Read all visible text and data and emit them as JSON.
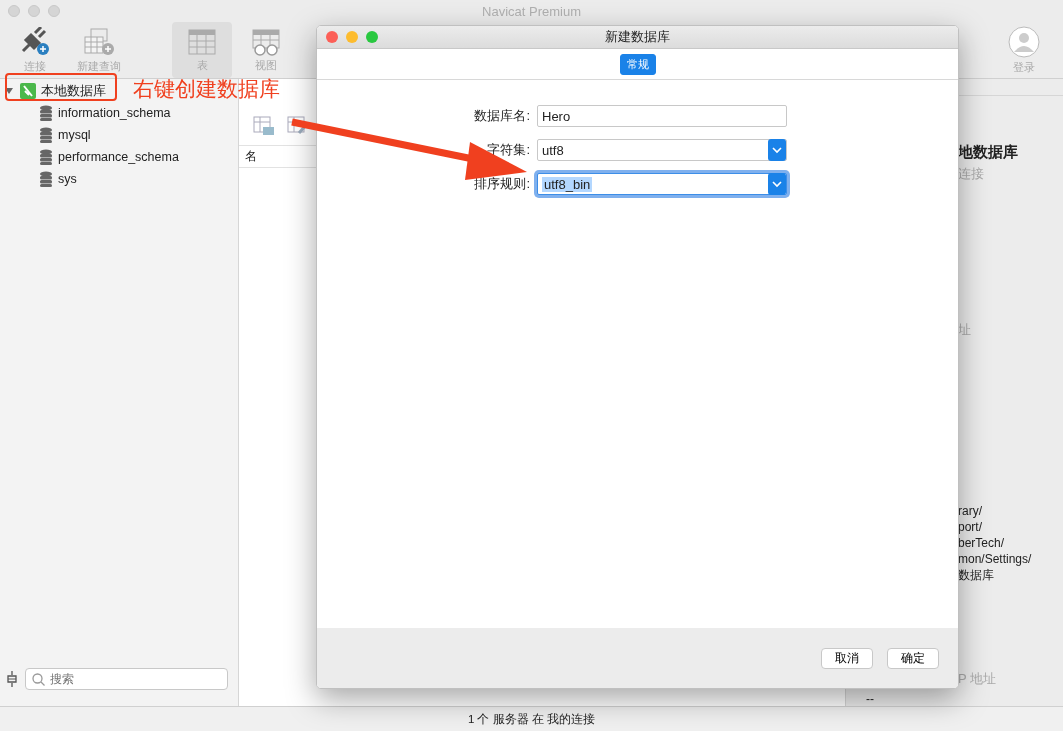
{
  "window": {
    "title": "Navicat Premium"
  },
  "toolbar": [
    {
      "kind": "connect",
      "label": "连接",
      "selected": false
    },
    {
      "kind": "query",
      "label": "新建查询",
      "selected": false
    },
    {
      "kind": "table",
      "label": "表",
      "selected": true
    },
    {
      "kind": "view",
      "label": "视图",
      "selected": false
    }
  ],
  "login": {
    "label": "登录"
  },
  "sidebar": {
    "tree": [
      {
        "label": "本地数据库",
        "expanded": true,
        "children": [
          {
            "label": "information_schema"
          },
          {
            "label": "mysql"
          },
          {
            "label": "performance_schema"
          },
          {
            "label": "sys"
          }
        ]
      }
    ],
    "search": {
      "placeholder": "搜索"
    }
  },
  "object_list": {
    "columns": [
      "名"
    ]
  },
  "info_panel": [
    {
      "kind": "title",
      "text": "地数据库"
    },
    {
      "kind": "subtitle",
      "text": "连接"
    },
    {
      "kind": "label",
      "text": "址"
    },
    {
      "kind": "path",
      "text": "rary/"
    },
    {
      "kind": "path",
      "text": "port/"
    },
    {
      "kind": "path",
      "text": "berTech/"
    },
    {
      "kind": "path",
      "text": "mon/Settings/"
    },
    {
      "kind": "path",
      "text": "数据库"
    },
    {
      "kind": "label",
      "text": "P 地址"
    },
    {
      "kind": "value",
      "text": "--"
    }
  ],
  "dialog": {
    "title": "新建数据库",
    "tabs": [
      {
        "label": "常规",
        "selected": true
      }
    ],
    "fields": [
      {
        "label": "数据库名:",
        "kind": "text",
        "value": "Hero",
        "focused": false
      },
      {
        "label": "字符集:",
        "kind": "select",
        "value": "utf8",
        "focused": false
      },
      {
        "label": "排序规则:",
        "kind": "select",
        "value": "utf8_bin",
        "focused": true
      }
    ],
    "buttons": [
      "取消",
      "确定"
    ]
  },
  "annotation": {
    "text": "右键创建数据库"
  },
  "status_bar": {
    "text": "1 个 服务器 在 我的连接"
  }
}
